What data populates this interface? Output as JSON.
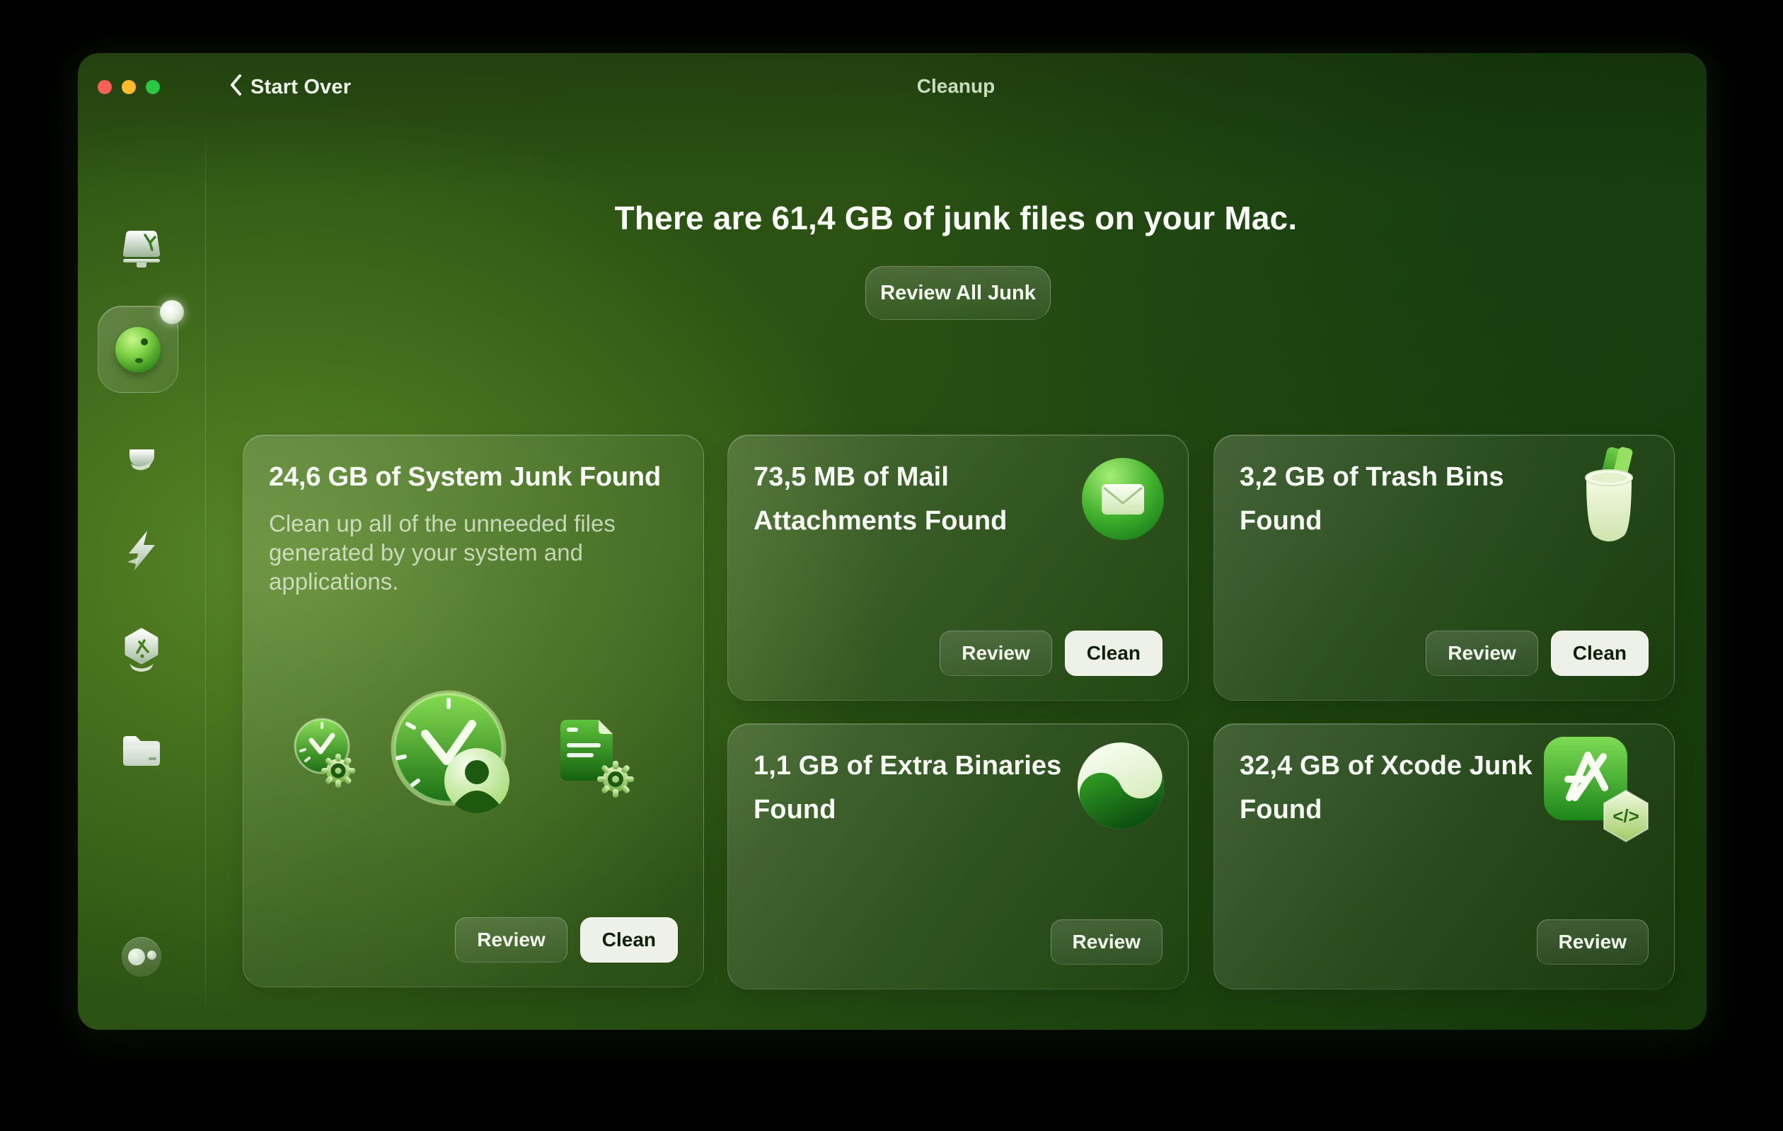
{
  "window": {
    "title": "Cleanup",
    "back_label": "Start Over"
  },
  "summary": {
    "headline": "There are 61,4 GB of junk files on your Mac.",
    "review_all_label": "Review All Junk"
  },
  "sidebar": {
    "items": [
      {
        "id": "cleanup-display",
        "icon": "monitor-clean-icon",
        "active": false
      },
      {
        "id": "smart-scan",
        "icon": "smart-scan-orb-icon",
        "active": true,
        "notification_dot": true
      },
      {
        "id": "protection",
        "icon": "hand-icon",
        "active": false
      },
      {
        "id": "performance",
        "icon": "lightning-icon",
        "active": false
      },
      {
        "id": "applications",
        "icon": "hexagon-a-icon",
        "active": false
      },
      {
        "id": "files",
        "icon": "folder-icon",
        "active": false
      }
    ],
    "assistant_icon": "bubbles-icon"
  },
  "cards": [
    {
      "id": "system-junk",
      "title": "24,6 GB of System Junk Found",
      "description": "Clean up all of the unneeded files generated by your system and applications.",
      "icons": [
        "clock-gear-icon",
        "clock-user-icon",
        "document-gear-icon"
      ],
      "review_label": "Review",
      "clean_label": "Clean"
    },
    {
      "id": "mail-attachments",
      "title": "73,5 MB of Mail Attachments Found",
      "icon": "mail-icon",
      "review_label": "Review",
      "clean_label": "Clean"
    },
    {
      "id": "trash-bins",
      "title": "3,2 GB of Trash Bins Found",
      "icon": "trash-bin-icon",
      "review_label": "Review",
      "clean_label": "Clean"
    },
    {
      "id": "extra-binaries",
      "title": "1,1 GB of Extra Binaries Found",
      "icon": "binaries-wave-icon",
      "review_label": "Review"
    },
    {
      "id": "xcode-junk",
      "title": "32,4 GB of Xcode Junk Found",
      "icon": "xcode-icon",
      "badge_glyph": "</>",
      "review_label": "Review"
    }
  ],
  "colors": {
    "window_green_bright": "#4a7a1e",
    "window_green_dark": "#143608",
    "card_highlight": "rgba(255,255,255,0.16)",
    "clean_button_bg": "#edf1e8",
    "clean_button_text": "#10200b",
    "traffic_red": "#ff5f57",
    "traffic_yellow": "#febc2e",
    "traffic_green": "#28c840"
  }
}
